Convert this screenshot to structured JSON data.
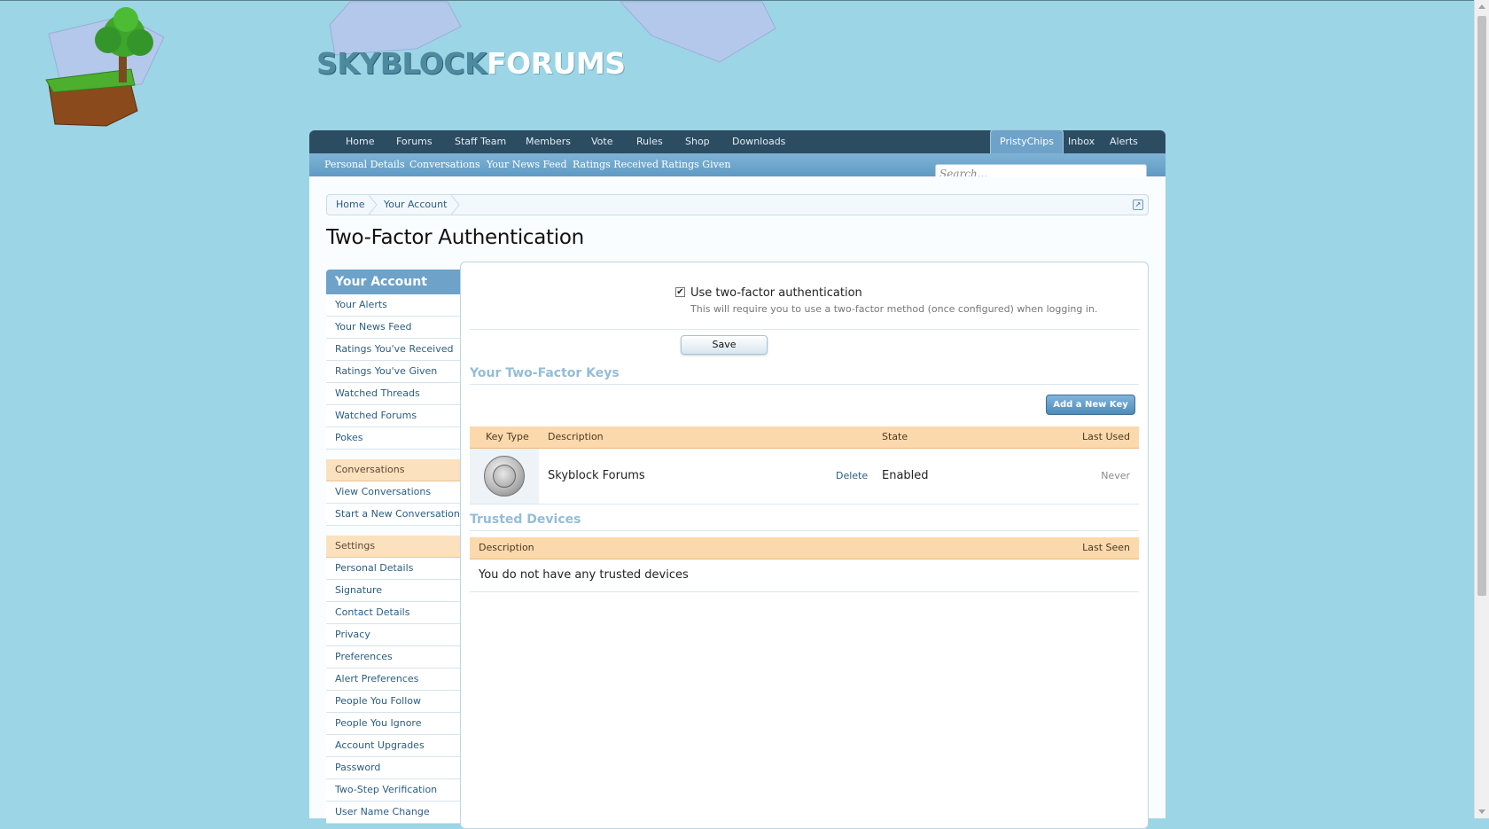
{
  "logo": {
    "part1": "SKYBLOCK",
    "part2": "FORUMS"
  },
  "nav": {
    "tabs": [
      "Home",
      "Forums",
      "Staff Team",
      "Members",
      "Vote",
      "Rules",
      "Shop",
      "Downloads"
    ],
    "user": "PristyChips",
    "inbox": "Inbox",
    "alerts": "Alerts"
  },
  "subnav": {
    "items": [
      "Personal Details",
      "Conversations",
      "Your News Feed",
      "Ratings Received",
      "Ratings Given"
    ],
    "search_placeholder": "Search..."
  },
  "breadcrumb": [
    "Home",
    "Your Account"
  ],
  "page_title": "Two-Factor Authentication",
  "sidebar": {
    "header": "Your Account",
    "account_items": [
      "Your Alerts",
      "Your News Feed",
      "Ratings You've Received",
      "Ratings You've Given",
      "Watched Threads",
      "Watched Forums",
      "Pokes"
    ],
    "conversations_header": "Conversations",
    "conversations_items": [
      "View Conversations",
      "Start a New Conversation"
    ],
    "settings_header": "Settings",
    "settings_items": [
      "Personal Details",
      "Signature",
      "Contact Details",
      "Privacy",
      "Preferences",
      "Alert Preferences",
      "People You Follow",
      "People You Ignore",
      "Account Upgrades",
      "Password",
      "Two-Step Verification",
      "User Name Change"
    ]
  },
  "tfa": {
    "checkbox_label": "Use two-factor authentication",
    "checkbox_checked": true,
    "checkbox_hint": "This will require you to use a two-factor method (once configured) when logging in.",
    "save_label": "Save",
    "keys_title": "Your Two-Factor Keys",
    "add_key_label": "Add a New Key",
    "keys_columns": [
      "Key Type",
      "Description",
      "State",
      "Last Used"
    ],
    "keys_rows": [
      {
        "description": "Skyblock Forums",
        "delete_label": "Delete",
        "state": "Enabled",
        "last_used": "Never"
      }
    ],
    "devices_title": "Trusted Devices",
    "devices_columns": [
      "Description",
      "Last Seen"
    ],
    "devices_empty": "You do not have any trusted devices"
  }
}
